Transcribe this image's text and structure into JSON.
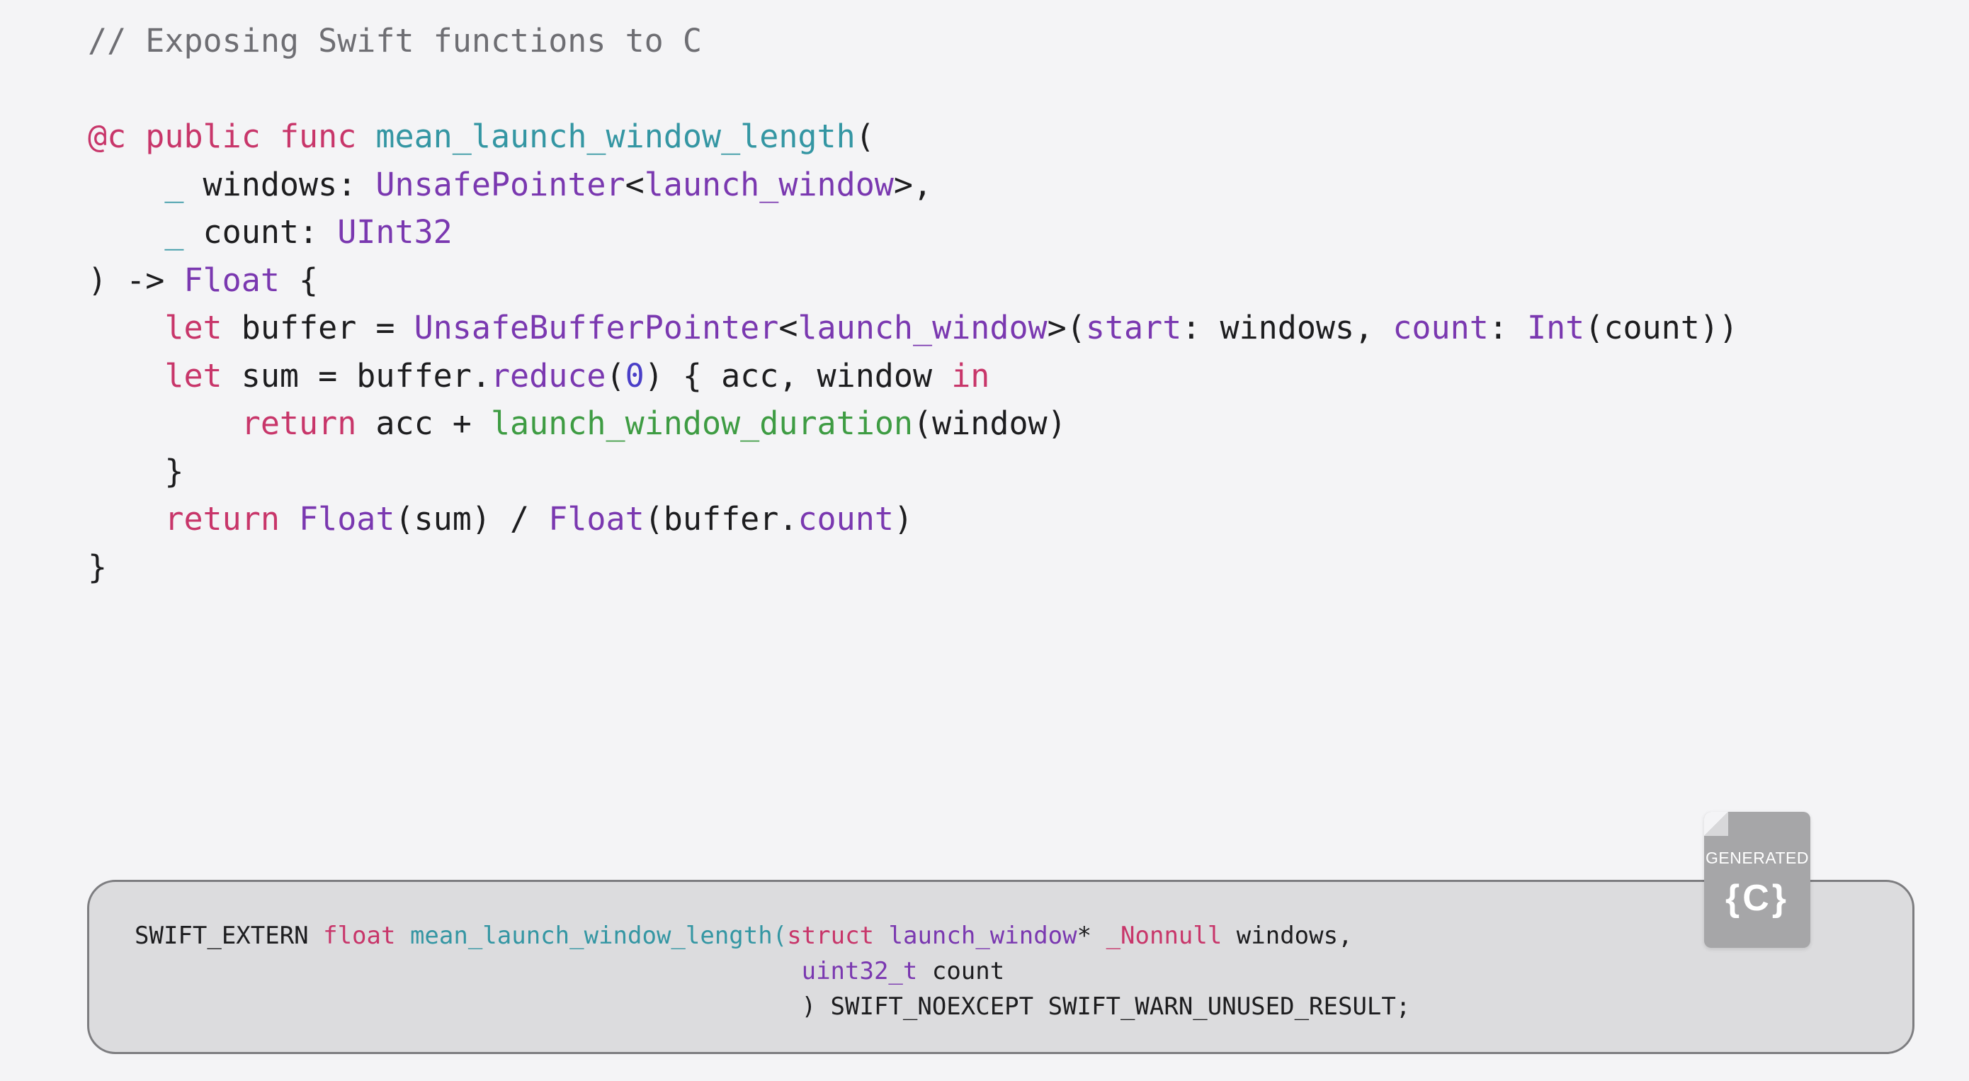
{
  "swift_code": {
    "comment": "// Exposing Swift functions to C",
    "decl": {
      "attr": "@c",
      "kw_public": "public",
      "kw_func": "func",
      "name": "mean_launch_window_length",
      "open_paren": "("
    },
    "param1": {
      "indent": "    ",
      "underscore": "_",
      "name": " windows: ",
      "type": "UnsafePointer",
      "lt": "<",
      "generic": "launch_window",
      "gt_comma": ">,"
    },
    "param2": {
      "indent": "    ",
      "underscore": "_",
      "name": " count: ",
      "type": "UInt32"
    },
    "return_line": {
      "prefix": ") -> ",
      "type": "Float",
      "suffix": " {"
    },
    "let_buffer": {
      "indent": "    ",
      "kw": "let",
      "mid": " buffer = ",
      "type": "UnsafeBufferPointer",
      "lt": "<",
      "generic": "launch_window",
      "gt_paren": ">(",
      "arg1": "start",
      "arg1_rest": ": windows, ",
      "arg2": "count",
      "colon": ": ",
      "int_type": "Int",
      "tail": "(count))"
    },
    "let_sum": {
      "indent": "    ",
      "kw": "let",
      "mid": " sum = buffer.",
      "method": "reduce",
      "open": "(",
      "zero": "0",
      "closure": ") { acc, window ",
      "kw_in": "in"
    },
    "closure_return": {
      "indent": "        ",
      "kw": "return",
      "mid": " acc + ",
      "fn": "launch_window_duration",
      "tail": "(window)"
    },
    "closure_close": "    }",
    "final_return": {
      "indent": "    ",
      "kw": "return",
      "sp": " ",
      "type1": "Float",
      "mid": "(sum) / ",
      "type2": "Float",
      "mid2": "(buffer.",
      "prop": "count",
      "tail": ")"
    },
    "close_brace": "}"
  },
  "generated_c": {
    "badge_label": "GENERATED",
    "badge_glyph": "{C}",
    "line1": {
      "macro": "SWIFT_EXTERN ",
      "kw_float": "float",
      "sp": " ",
      "name": "mean_launch_window_length",
      "open": "(",
      "kw_struct": "struct",
      "sp2": " ",
      "type": "launch_window",
      "star": "* ",
      "nonnull": "_Nonnull",
      "tail": " windows,"
    },
    "line2": {
      "indent": "                                              ",
      "type": "uint32_t",
      "tail": " count"
    },
    "line3": {
      "indent": "                                              ",
      "text": ") SWIFT_NOEXCEPT SWIFT_WARN_UNUSED_RESULT;"
    },
    "colors": {
      "panel_bg": "#dcdcde",
      "panel_border": "#7d7d80",
      "badge_bg": "#a6a6a8"
    }
  },
  "theme": {
    "background": "#f4f4f6",
    "keyword": "#c8366a",
    "function": "#3496a3",
    "type": "#7a38b0",
    "green_fn": "#3e9c43",
    "number": "#4a3fc8",
    "comment": "#6e6e73"
  }
}
